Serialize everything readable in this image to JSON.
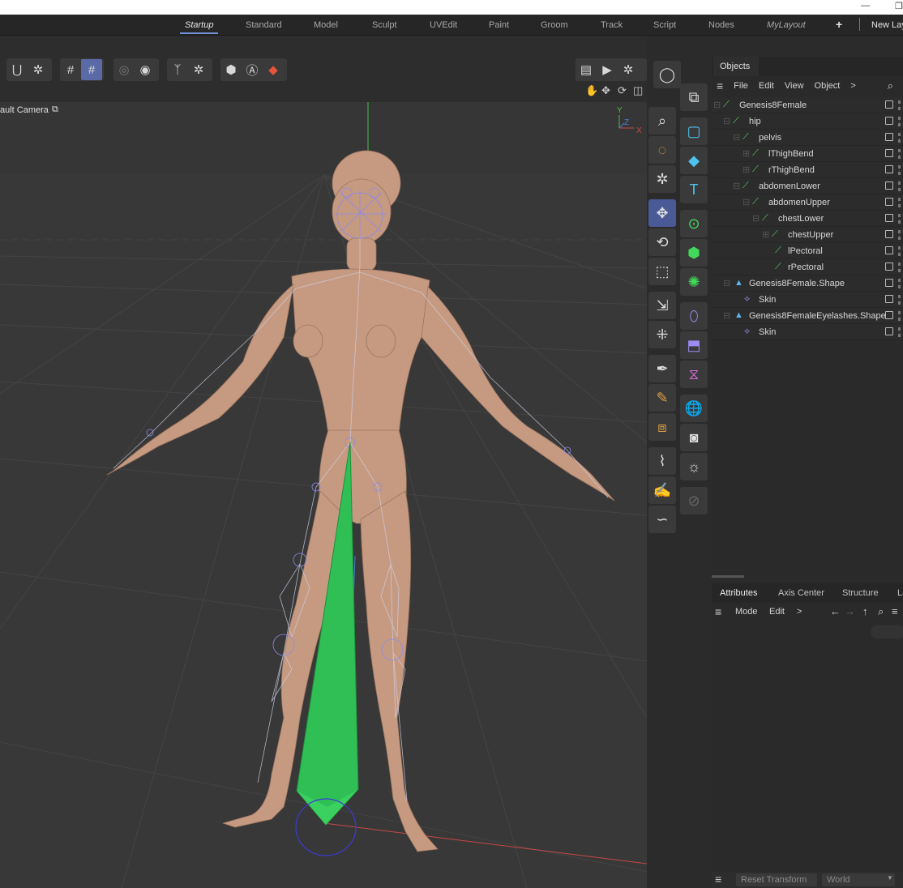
{
  "layout_tabs": {
    "startup": "Startup",
    "standard": "Standard",
    "model": "Model",
    "sculpt": "Sculpt",
    "uvedit": "UVEdit",
    "paint": "Paint",
    "groom": "Groom",
    "track": "Track",
    "script": "Script",
    "nodes": "Nodes",
    "mylayout": "MyLayout",
    "add": "+",
    "new_layout": "New Lay"
  },
  "window_controls": {
    "minimize": "—",
    "restore": "❐"
  },
  "viewport": {
    "camera_label": "ault Camera",
    "camera_icon": "camera-icon",
    "axis": {
      "y": "Y",
      "z": "Z",
      "x": "X"
    }
  },
  "objects_manager": {
    "tab": "Objects",
    "menu": [
      "File",
      "Edit",
      "View",
      "Object",
      ">"
    ],
    "tree": [
      {
        "name": "Genesis8Female",
        "type": "joint"
      },
      {
        "name": "hip",
        "type": "joint"
      },
      {
        "name": "pelvis",
        "type": "joint"
      },
      {
        "name": "lThighBend",
        "type": "joint"
      },
      {
        "name": "rThighBend",
        "type": "joint"
      },
      {
        "name": "abdomenLower",
        "type": "joint"
      },
      {
        "name": "abdomenUpper",
        "type": "joint"
      },
      {
        "name": "chestLower",
        "type": "joint"
      },
      {
        "name": "chestUpper",
        "type": "joint"
      },
      {
        "name": "lPectoral",
        "type": "joint"
      },
      {
        "name": "rPectoral",
        "type": "joint"
      },
      {
        "name": "Genesis8Female.Shape",
        "type": "shape"
      },
      {
        "name": "Skin",
        "type": "skin"
      },
      {
        "name": "Genesis8FemaleEyelashes.Shape",
        "type": "shape"
      },
      {
        "name": "Skin",
        "type": "skin"
      }
    ]
  },
  "attributes": {
    "tabs": [
      "Attributes",
      "Axis Center",
      "Structure",
      "La"
    ],
    "menu": {
      "mode": "Mode",
      "edit": "Edit",
      "more": ">"
    },
    "bottom": {
      "reset": "Reset Transform",
      "world": "World"
    }
  },
  "colors": {
    "accent": "#5a6aa6",
    "joint_green": "#5fd36a",
    "selected_bone": "#2fbf55",
    "axis_x": "#c94848",
    "axis_y": "#4bbf4b",
    "axis_z": "#4b7bd6"
  }
}
